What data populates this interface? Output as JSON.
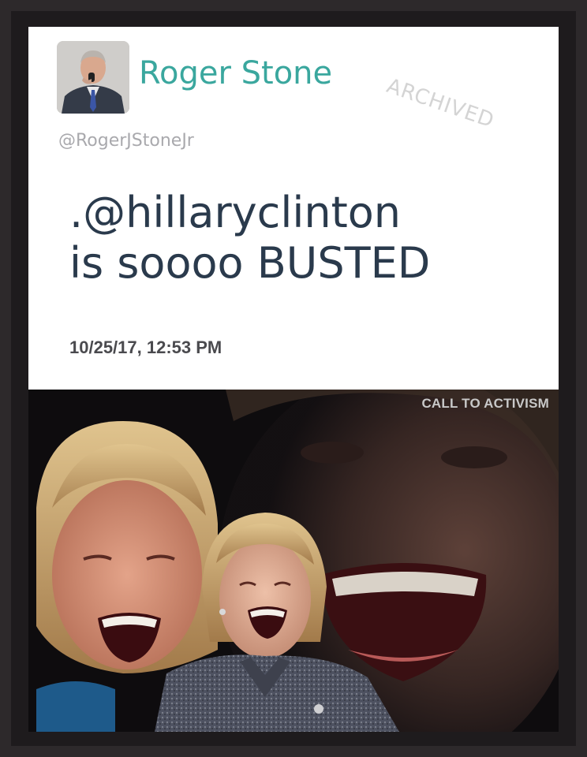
{
  "tweet": {
    "display_name": "Roger Stone",
    "handle": "@RogerJStoneJr",
    "text_lines": [
      ".@hillaryclinton",
      "is soooo BUSTED"
    ],
    "timestamp": "10/25/17, 12:53 PM",
    "watermark": "ARCHIVED",
    "name_color": "#3aa79e"
  },
  "photo": {
    "credit": "CALL TO ACTIVISM"
  },
  "icons": {
    "avatar": "profile-photo"
  }
}
